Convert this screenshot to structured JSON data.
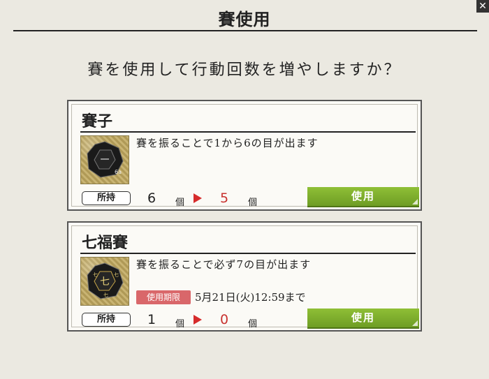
{
  "dialog": {
    "title": "賽使用",
    "question": "賽を使用して行動回数を増やしますか？",
    "close_icon": "close-icon"
  },
  "items": [
    {
      "name": "賽子",
      "description": "賽を振ることで1から6の目が出ます",
      "icon": "dice-icon",
      "owned_label": "所持",
      "count_before": "6",
      "count_after": "5",
      "unit": "個",
      "use_label": "使用"
    },
    {
      "name": "七福賽",
      "description": "賽を振ることで必ず7の目が出ます",
      "icon": "lucky-dice-icon",
      "expiry_label": "使用期限",
      "expiry_date": "5月21日(火)12:59まで",
      "owned_label": "所持",
      "count_before": "1",
      "count_after": "0",
      "unit": "個",
      "use_label": "使用"
    }
  ],
  "colors": {
    "background": "#ebe9e1",
    "accent_green": "#7caf2c",
    "count_red": "#c8322f",
    "badge_red": "#d9676a"
  }
}
